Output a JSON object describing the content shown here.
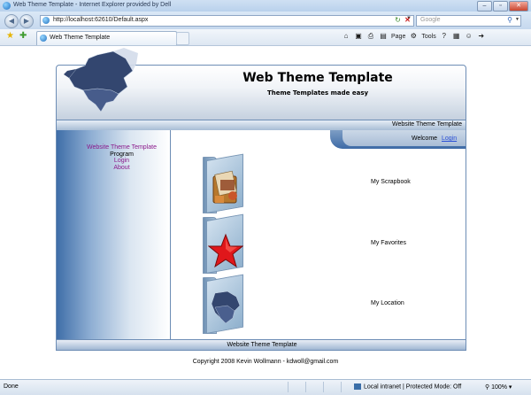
{
  "browser": {
    "window_title": "Web Theme Template - Internet Explorer provided by Dell",
    "url": "http://localhost:62610/Default.aspx",
    "search_placeholder": "Google",
    "tab_title": "Web Theme Template",
    "cmd_page": "Page",
    "cmd_tools": "Tools",
    "win_minimize": "–",
    "win_restore": "▫",
    "win_close": "✕"
  },
  "site": {
    "title": "Web Theme Template",
    "subtitle": "Theme Templates made easy",
    "strip_label": "Website Theme Template",
    "footer_label": "Website Theme Template",
    "copyright": "Copyright 2008 Kevin Wollmann - kdwoll@gmail.com"
  },
  "menu": {
    "items": [
      "Website Theme Template",
      "Program",
      "Login",
      "About"
    ]
  },
  "welcome": {
    "text": "Welcome",
    "login": "Login"
  },
  "items": [
    {
      "label": "My Scrapbook",
      "icon": "scrapbook-folder-icon"
    },
    {
      "label": "My Favorites",
      "icon": "star-folder-icon"
    },
    {
      "label": "My Location",
      "icon": "map-folder-icon"
    }
  ],
  "status": {
    "left": "Done",
    "zone": "Local intranet | Protected Mode: Off",
    "zoom": "100%"
  },
  "colors": {
    "menu_link": "#8b1a8b",
    "login_link": "#2a4fd6",
    "theme_blue": "#3f6ea8"
  }
}
